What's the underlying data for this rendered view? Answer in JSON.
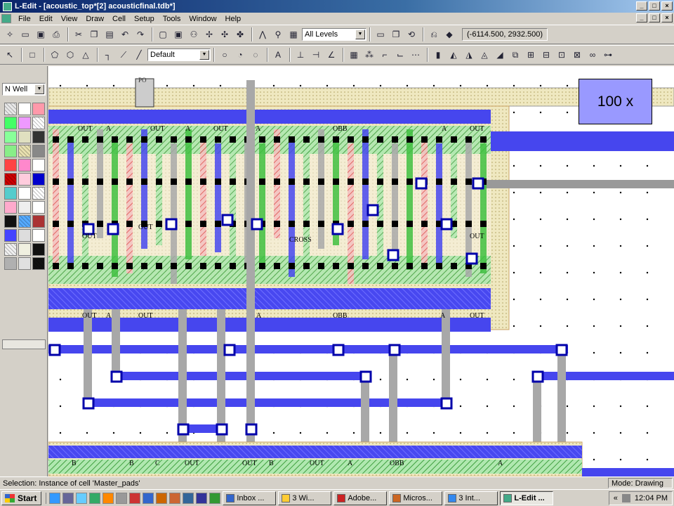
{
  "window": {
    "title": "L-Edit - [acoustic_top*[2]     acousticfinal.tdb*]"
  },
  "menu": [
    "File",
    "Edit",
    "View",
    "Draw",
    "Cell",
    "Setup",
    "Tools",
    "Window",
    "Help"
  ],
  "toolbar": {
    "level_select": "All Levels",
    "style_select": "Default",
    "coordinates": "(-6114.500, 2932.500)"
  },
  "palette": {
    "layer_select": "N Well",
    "swatch_colors": [
      "#e8e8e8",
      "#ffffff",
      "#ff99aa",
      "#44ff66",
      "#ee99ff",
      "#ffffff",
      "#88ff99",
      "#e0e0c0",
      "#333333",
      "#88ee88",
      "#e8e0b0",
      "#888888",
      "#ff4444",
      "#ff88cc",
      "#ffffff",
      "#cc0000",
      "#ffccdd",
      "#0000cc",
      "#55cccc",
      "#ffffff",
      "#ffffff",
      "#ffaacc",
      "#eeeeee",
      "#ffffff",
      "#111111",
      "#55aaff",
      "#aa3333",
      "#4444ff",
      "#dddddd",
      "#ffffff",
      "#f0f0f0",
      "#f0f0e0",
      "#111111",
      "#b0b0b0",
      "#e0e0e0",
      "#111111"
    ]
  },
  "canvas": {
    "labels_top_row": [
      "OUT",
      "A",
      "OUT",
      "A",
      "OUT",
      "A",
      "OBB",
      "A",
      "OUT"
    ],
    "labels_mid": [
      "OUT",
      "OUT",
      "CROSS",
      "OUT"
    ],
    "labels_bottom_row": [
      "OUT",
      "A",
      "OUT",
      "A",
      "OBB",
      "A",
      "OUT"
    ],
    "labels_lowest_row": [
      "B",
      "B",
      "C",
      "OUT",
      "OUT",
      "B",
      "OUT",
      "A",
      "OBB",
      "A"
    ],
    "pad_label": "PO"
  },
  "callout": {
    "text": "100 x"
  },
  "status": {
    "selection": "Selection: Instance of cell 'Master_pads'",
    "mode": "Mode: Drawing"
  },
  "taskbar": {
    "start": "Start",
    "tasks": [
      {
        "label": "Inbox ...",
        "color": "#3366cc"
      },
      {
        "label": "3 Wi...",
        "color": "#ffcc33"
      },
      {
        "label": "Adobe...",
        "color": "#cc2222"
      },
      {
        "label": "Micros...",
        "color": "#cc6622"
      },
      {
        "label": "3 Int...",
        "color": "#3388ee"
      },
      {
        "label": "L-Edit ...",
        "color": "#44aa88"
      }
    ],
    "clock": "12:04 PM"
  }
}
